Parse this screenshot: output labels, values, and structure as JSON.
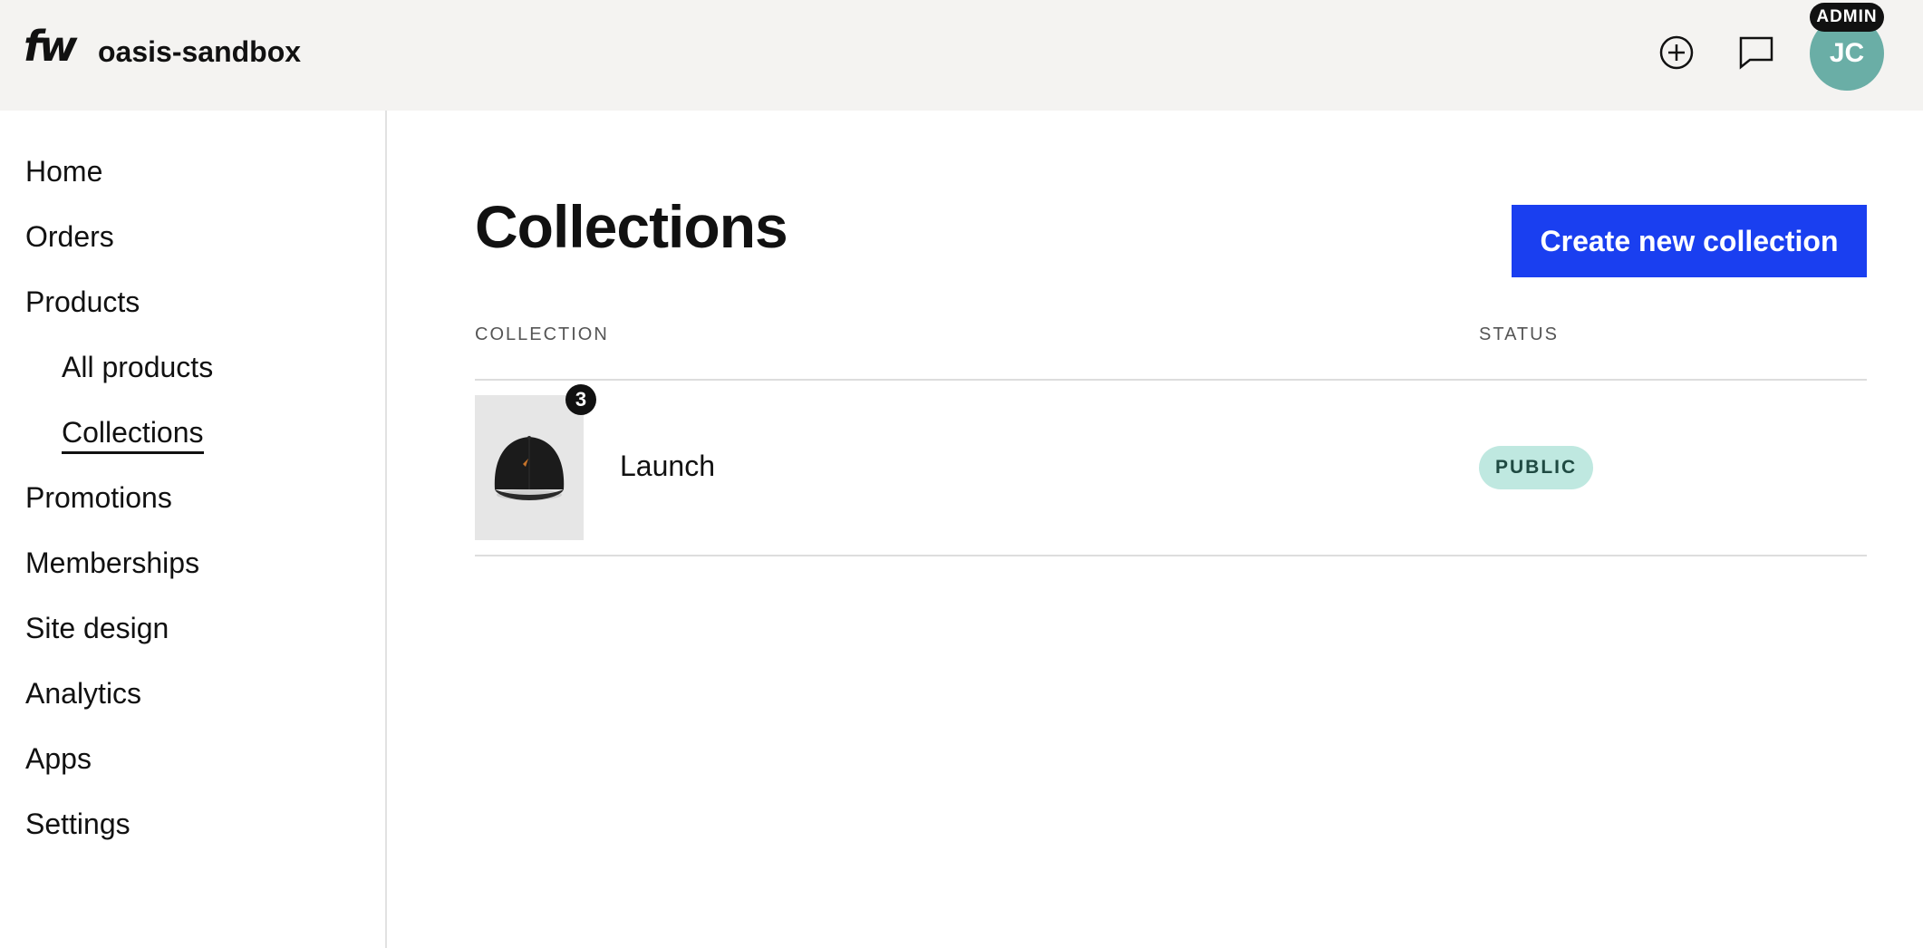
{
  "header": {
    "logo": "fw",
    "store_name": "oasis-sandbox",
    "admin_badge": "ADMIN",
    "avatar_initials": "JC",
    "icons": [
      "plus-circle-icon",
      "chat-icon"
    ]
  },
  "sidebar": {
    "items": [
      {
        "label": "Home"
      },
      {
        "label": "Orders"
      },
      {
        "label": "Products"
      },
      {
        "label": "All products"
      },
      {
        "label": "Collections"
      },
      {
        "label": "Promotions"
      },
      {
        "label": "Memberships"
      },
      {
        "label": "Site design"
      },
      {
        "label": "Analytics"
      },
      {
        "label": "Apps"
      },
      {
        "label": "Settings"
      }
    ],
    "active": "Collections"
  },
  "main": {
    "title": "Collections",
    "create_button": "Create new collection",
    "columns": {
      "collection": "COLLECTION",
      "status": "STATUS"
    },
    "rows": [
      {
        "name": "Launch",
        "count": "3",
        "status": "PUBLIC"
      }
    ]
  },
  "colors": {
    "accent": "#1a3ff0",
    "avatar": "#6aaea6",
    "status_public_bg": "#bfe8e0",
    "header_bg": "#f4f3f1"
  }
}
